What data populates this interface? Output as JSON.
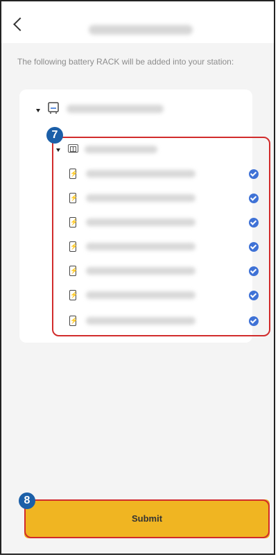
{
  "header": {
    "back_icon": "chevron-left-icon"
  },
  "subtitle": "The following battery RACK will be added into your station:",
  "annotations": {
    "rack_marker": "7",
    "submit_marker": "8"
  },
  "batteries": [
    {
      "icon": "battery-icon",
      "checked": true
    },
    {
      "icon": "battery-icon",
      "checked": true
    },
    {
      "icon": "battery-icon",
      "checked": true
    },
    {
      "icon": "battery-icon",
      "checked": true
    },
    {
      "icon": "battery-icon",
      "checked": true
    },
    {
      "icon": "battery-icon",
      "checked": true
    },
    {
      "icon": "battery-icon",
      "checked": true
    }
  ],
  "battery_glyph": "⚡",
  "submit_label": "Submit",
  "colors": {
    "accent": "#f0b522",
    "check": "#3f72d6",
    "highlight": "#d12b2b",
    "marker": "#1b5fa8"
  }
}
